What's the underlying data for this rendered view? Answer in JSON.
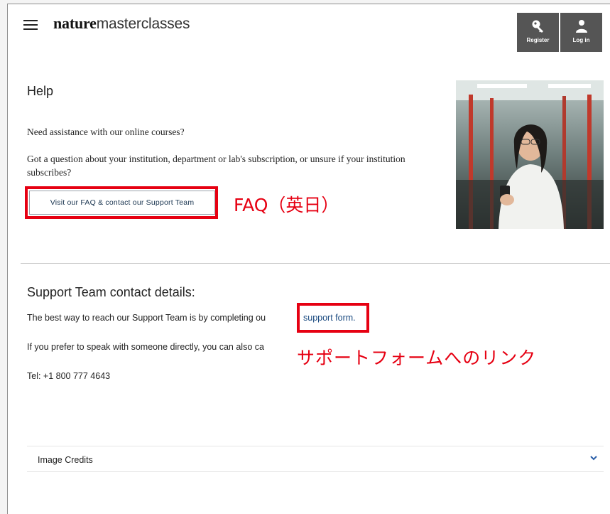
{
  "header": {
    "logo_bold": "nature",
    "logo_light": "masterclasses",
    "register_label": "Register",
    "login_label": "Log in"
  },
  "help": {
    "title": "Help",
    "question1": "Need assistance with our online courses?",
    "question2": "Got a question about your institution, department or lab's subscription, or unsure if your institution subscribes?",
    "faq_button": "Visit our FAQ & contact our Support Team"
  },
  "annotations": {
    "faq_note": "FAQ（英日）",
    "form_note": "サポートフォームへのリンク",
    "highlight_color": "#e60012"
  },
  "support": {
    "title": "Support Team contact details:",
    "line1": "The best way to reach our Support Team is by completing ou",
    "link": "support form.",
    "line2": "If you prefer to speak with someone directly, you can also ca",
    "tel": "Tel: +1 800 777 4643"
  },
  "credits": {
    "label": "Image Credits"
  },
  "icons": {
    "menu": "hamburger-menu-icon",
    "register": "key-icon",
    "login": "user-icon",
    "expand": "chevron-down-icon"
  }
}
